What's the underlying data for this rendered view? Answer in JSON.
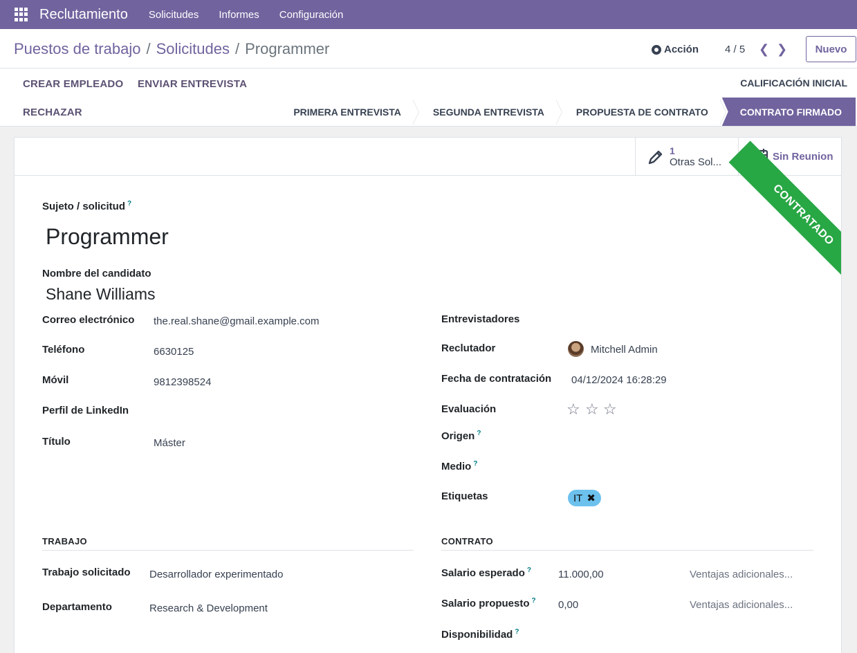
{
  "navbar": {
    "app_icon": "apps-grid-icon",
    "brand": "Reclutamiento",
    "menu": [
      "Solicitudes",
      "Informes",
      "Configuración"
    ]
  },
  "breadcrumb": {
    "items": [
      "Puestos de trabajo",
      "Solicitudes"
    ],
    "current": "Programmer"
  },
  "toolbar": {
    "action_label": "Acción",
    "pager": "4 / 5",
    "new_label": "Nuevo"
  },
  "statusbar": {
    "buttons": [
      "CREAR EMPLEADO",
      "ENVIAR ENTREVISTA",
      "RECHAZAR"
    ],
    "stage_top": "CALIFICACIÓN INICIAL",
    "stages": [
      "PRIMERA ENTREVISTA",
      "SEGUNDA ENTREVISTA",
      "PROPUESTA DE CONTRATO",
      "CONTRATO FIRMADO"
    ],
    "active_stage": "CONTRATO FIRMADO"
  },
  "smart_buttons": {
    "other_count": "1",
    "other_label": "Otras Sol...",
    "meetings_label": "Sin Reunion"
  },
  "ribbon": "CONTRATADO",
  "form": {
    "subject_label": "Sujeto / solicitud",
    "subject": "Programmer",
    "candidate_label": "Nombre del candidato",
    "candidate": "Shane Williams",
    "left": {
      "email_label": "Correo electrónico",
      "email": "the.real.shane@gmail.example.com",
      "phone_label": "Teléfono",
      "phone": "6630125",
      "mobile_label": "Móvil",
      "mobile": "9812398524",
      "linkedin_label": "Perfil de LinkedIn",
      "degree_label": "Título",
      "degree": "Máster"
    },
    "right": {
      "interviewers_label": "Entrevistadores",
      "recruiter_label": "Reclutador",
      "recruiter": "Mitchell Admin",
      "hire_date_label": "Fecha de contratación",
      "hire_date": "04/12/2024 16:28:29",
      "evaluation_label": "Evaluación",
      "evaluation": 0,
      "source_label": "Origen",
      "medium_label": "Medio",
      "tags_label": "Etiquetas",
      "tag": "IT"
    },
    "job": {
      "section": "TRABAJO",
      "applied_label": "Trabajo solicitado",
      "applied": "Desarrollador experimentado",
      "department_label": "Departamento",
      "department": "Research & Development"
    },
    "contract": {
      "section": "CONTRATO",
      "expected_label": "Salario esperado",
      "expected": "11.000,00",
      "expected_extra": "Ventajas adicionales...",
      "proposed_label": "Salario propuesto",
      "proposed": "0,00",
      "proposed_extra": "Ventajas adicionales...",
      "availability_label": "Disponibilidad"
    }
  },
  "colors": {
    "brand": "#71639e",
    "ribbon": "#28a745",
    "tag": "#6cc1ed"
  }
}
